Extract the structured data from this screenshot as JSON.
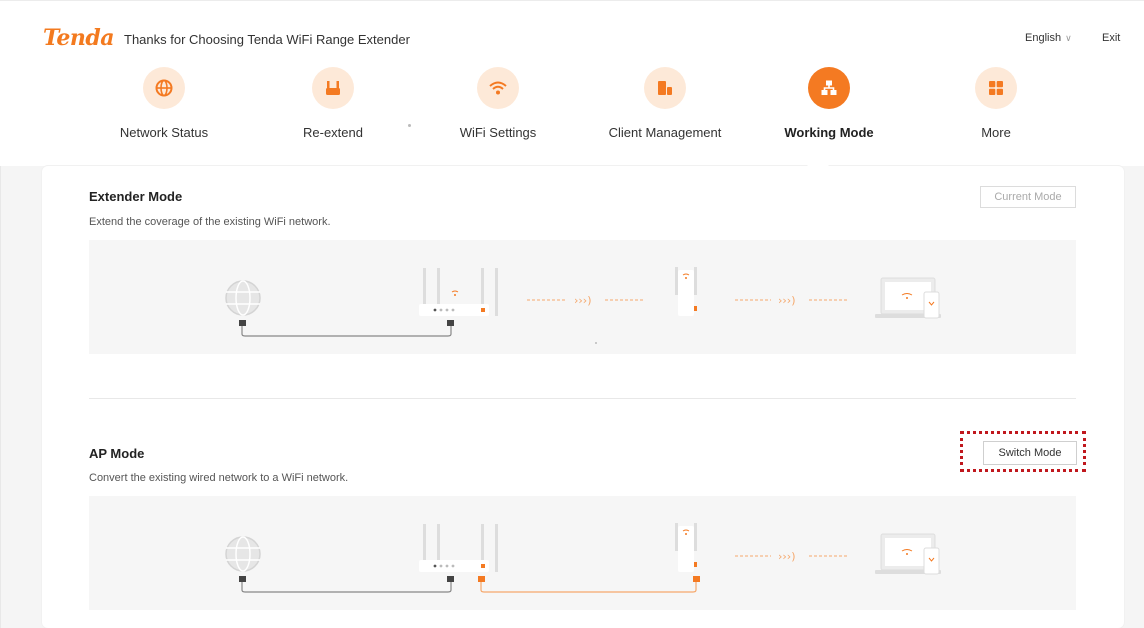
{
  "header": {
    "brand": "Tenda",
    "title": "Thanks for Choosing Tenda WiFi Range Extender",
    "language": "English",
    "exit_label": "Exit"
  },
  "nav": {
    "items": [
      {
        "label": "Network Status",
        "icon": "globe-icon"
      },
      {
        "label": "Re-extend",
        "icon": "extender-icon"
      },
      {
        "label": "WiFi Settings",
        "icon": "wifi-icon"
      },
      {
        "label": "Client Management",
        "icon": "client-icon"
      },
      {
        "label": "Working Mode",
        "icon": "network-icon",
        "active": true
      },
      {
        "label": "More",
        "icon": "grid-icon"
      }
    ]
  },
  "extender_mode": {
    "title": "Extender Mode",
    "description": "Extend the coverage of the existing WiFi network.",
    "button_label": "Current Mode"
  },
  "ap_mode": {
    "title": "AP Mode",
    "description": "Convert the existing wired network to a WiFi network.",
    "button_label": "Switch Mode"
  },
  "colors": {
    "accent": "#f47a22",
    "accent_light": "#fde9d8",
    "highlight": "#c0171d"
  }
}
